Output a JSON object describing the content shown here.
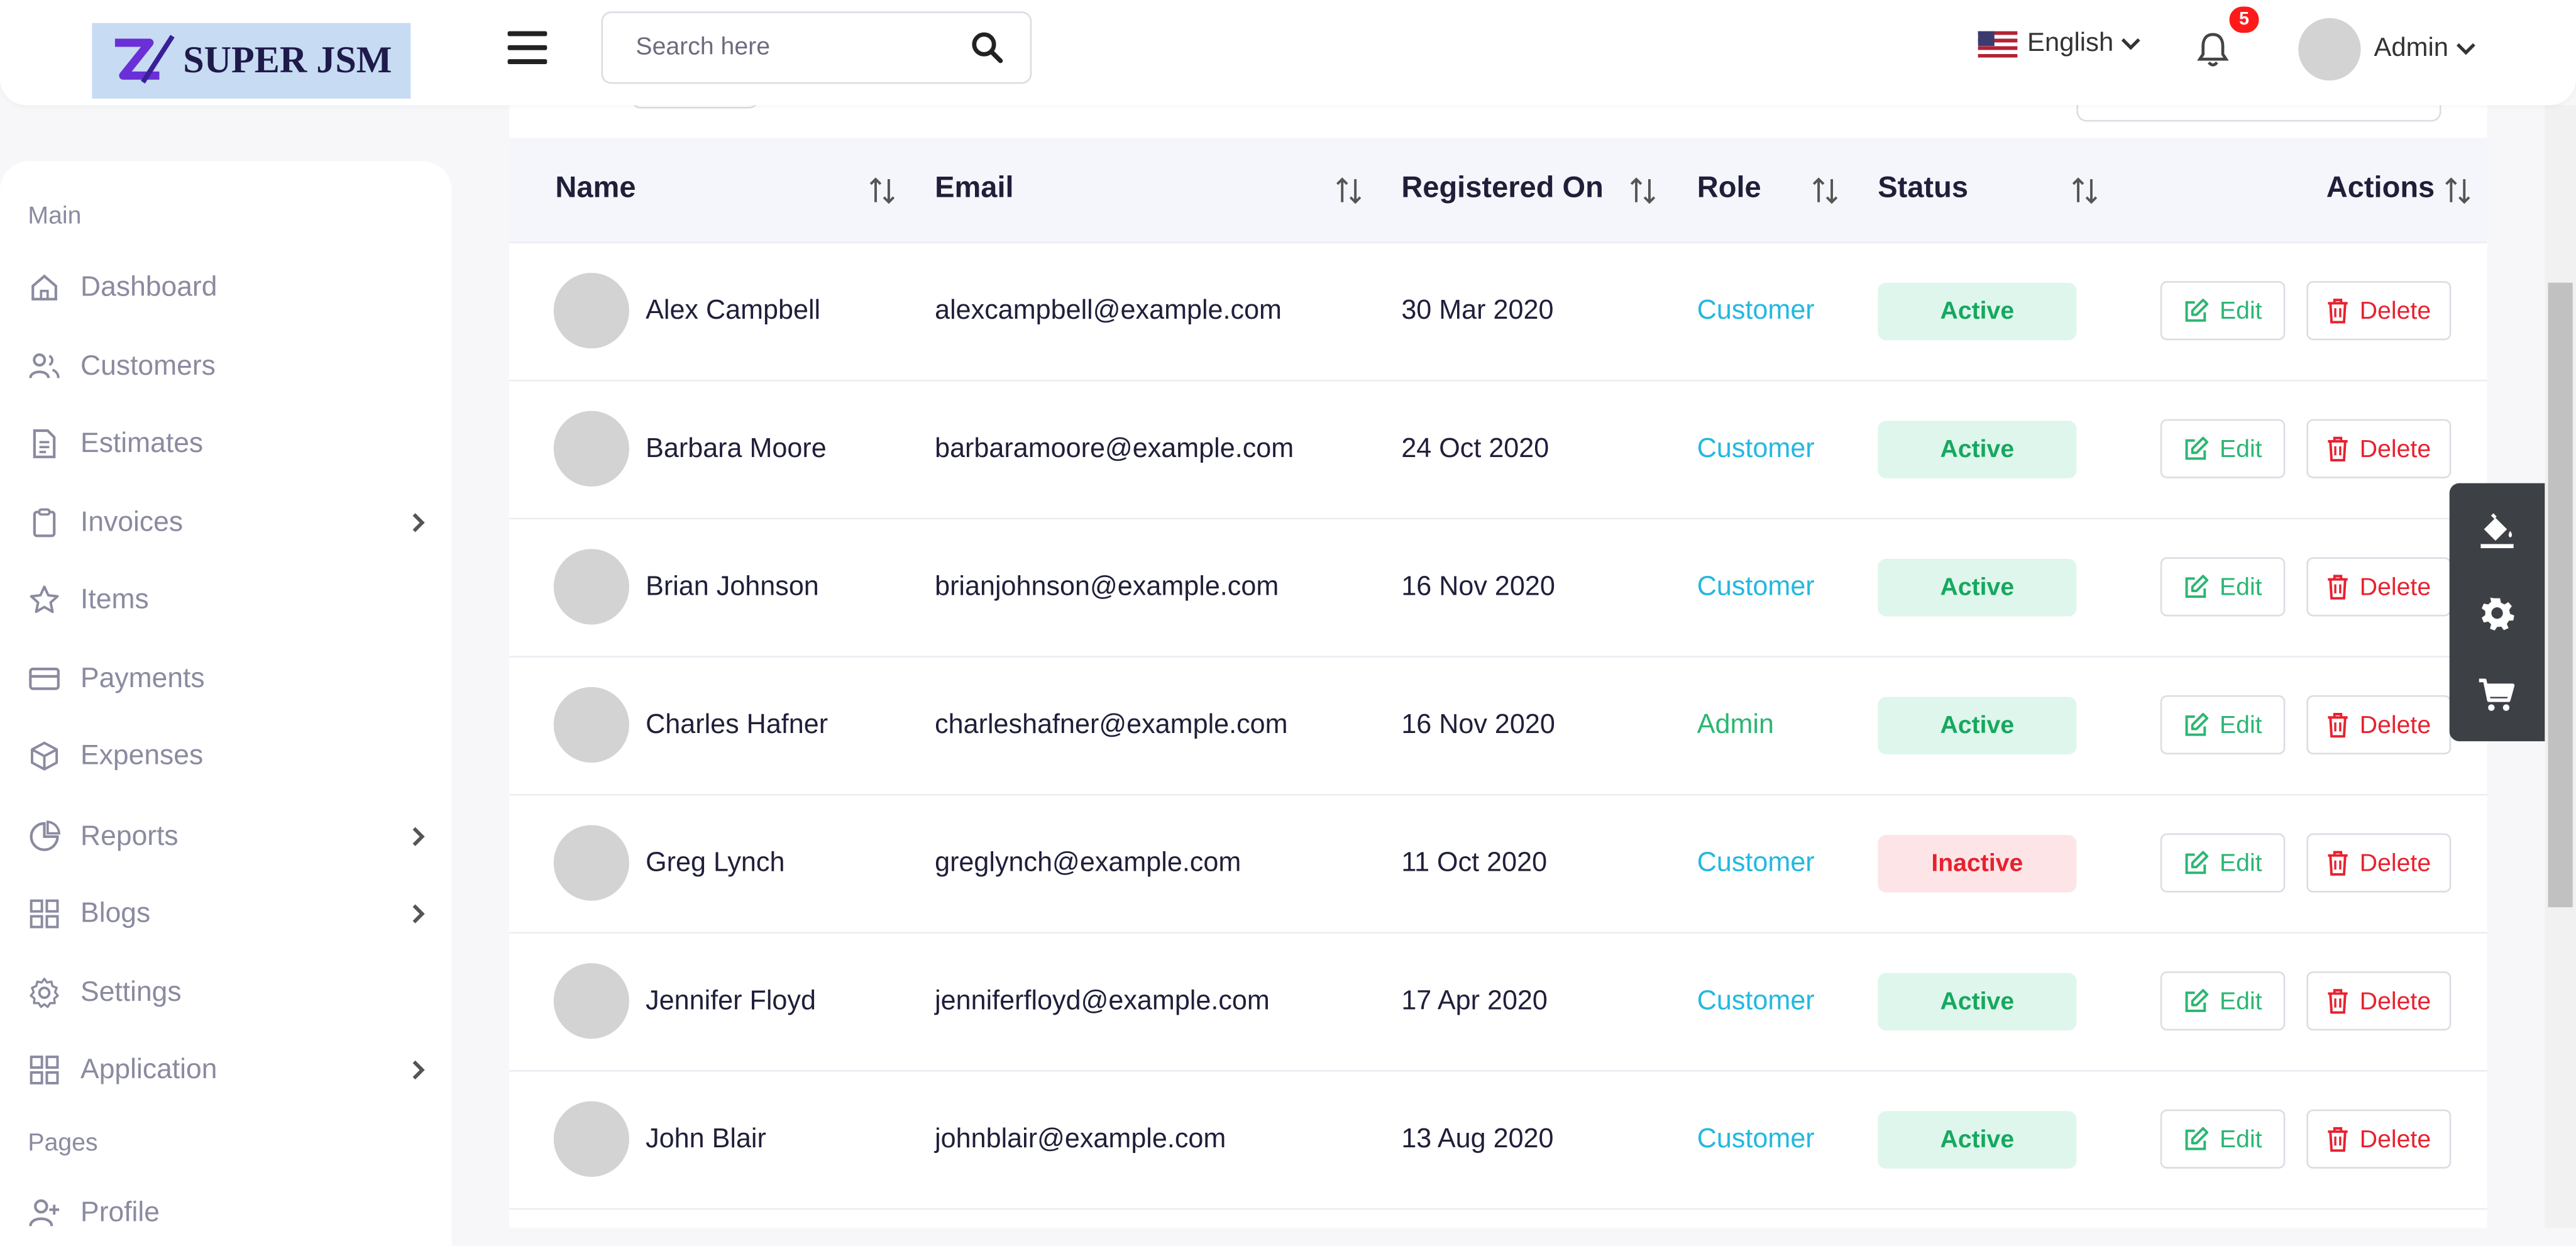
{
  "brand": {
    "name": "SUPER JSM"
  },
  "search": {
    "placeholder": "Search here"
  },
  "header": {
    "language": "English",
    "notifications": "5",
    "user": "Admin"
  },
  "sidebar": {
    "section_main": "Main",
    "section_pages": "Pages",
    "items": [
      {
        "label": "Dashboard"
      },
      {
        "label": "Customers"
      },
      {
        "label": "Estimates"
      },
      {
        "label": "Invoices"
      },
      {
        "label": "Items"
      },
      {
        "label": "Payments"
      },
      {
        "label": "Expenses"
      },
      {
        "label": "Reports"
      },
      {
        "label": "Blogs"
      },
      {
        "label": "Settings"
      },
      {
        "label": "Application"
      },
      {
        "label": "Profile"
      }
    ]
  },
  "table": {
    "columns": [
      "Name",
      "Email",
      "Registered On",
      "Role",
      "Status",
      "Actions"
    ],
    "edit_label": "Edit",
    "delete_label": "Delete",
    "rows": [
      {
        "name": "Alex Campbell",
        "email": "alexcampbell@example.com",
        "registered": "30 Mar 2020",
        "role": "Customer",
        "status": "Active"
      },
      {
        "name": "Barbara Moore",
        "email": "barbaramoore@example.com",
        "registered": "24 Oct 2020",
        "role": "Customer",
        "status": "Active"
      },
      {
        "name": "Brian Johnson",
        "email": "brianjohnson@example.com",
        "registered": "16 Nov 2020",
        "role": "Customer",
        "status": "Active"
      },
      {
        "name": "Charles Hafner",
        "email": "charleshafner@example.com",
        "registered": "16 Nov 2020",
        "role": "Admin",
        "status": "Active"
      },
      {
        "name": "Greg Lynch",
        "email": "greglynch@example.com",
        "registered": "11 Oct 2020",
        "role": "Customer",
        "status": "Inactive"
      },
      {
        "name": "Jennifer Floyd",
        "email": "jenniferfloyd@example.com",
        "registered": "17 Apr 2020",
        "role": "Customer",
        "status": "Active"
      },
      {
        "name": "John Blair",
        "email": "johnblair@example.com",
        "registered": "13 Aug 2020",
        "role": "Customer",
        "status": "Active"
      }
    ]
  },
  "floating_tools": [
    "paint-bucket-icon",
    "gear-icon",
    "cart-icon"
  ],
  "colors": {
    "accent": "#22b8e0",
    "admin_role": "#2bb673",
    "active": "#16a85f",
    "inactive": "#e8212f"
  }
}
